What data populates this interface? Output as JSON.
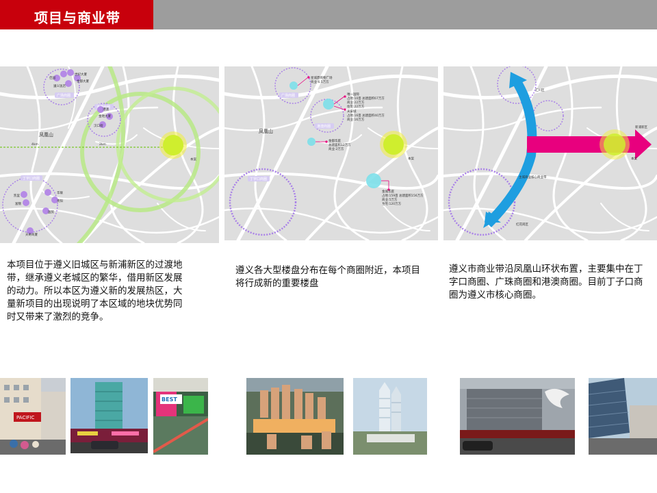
{
  "header": {
    "title": "项目与商业带",
    "accent_color": "#c8000c",
    "bar_color": "#9d9d9d"
  },
  "maps": [
    {
      "labels": {
        "fenghuangshan": "凤凰山",
        "project": "本案",
        "km4": "4km",
        "km2": "2km",
        "ring_a": "广场商圈",
        "ring_b": "港澳商圈",
        "ring_c": "丁字口商圈",
        "p1": "世纪大厦",
        "p2": "金都大厦",
        "p3": "佳园",
        "p4": "遵义饭店",
        "p5": "金地大厦",
        "p6": "汉口街",
        "p7": "港澳",
        "p8": "凯里",
        "p9": "富锦",
        "p10": "华联",
        "p11": "贵阳",
        "p12": "国贸",
        "p13": "天奇商厦"
      }
    },
    {
      "labels": {
        "fenghuangshan": "凤凰山",
        "project": "本案",
        "ring_a": "广场商圈",
        "ring_b": "港澳商圈",
        "ring_c": "丁字口商圈",
        "c1": "星城鼎购物广场",
        "c1b": "商业:6.5万方",
        "c2": "唯一国际",
        "c2b": "占地:10亩 总建面积67万方",
        "c2c": "商业:22万方",
        "c2d": "住宅:22万方",
        "c3": "天安城",
        "c3b": "占地:16亩 总建面积40万方",
        "c3c": "商业:16万方",
        "c4": "金都华庭",
        "c4b": "总建面积12万方",
        "c4c": "商业:2万方",
        "c5": "金城华庭",
        "c5b": "占地:159亩 总建面积156万方",
        "c5c": "商业:5万方",
        "c5d": "住宅:120万方"
      }
    },
    {
      "labels": {
        "huichuan": "汇川区",
        "xinpu": "新浦新区",
        "project": "本案",
        "honghuagang": "红花岗区",
        "core": "主城商业核心商业带"
      },
      "arrow_colors": {
        "blue": "#1e9ee0",
        "magenta": "#e8007e"
      }
    }
  ],
  "descriptions": [
    "本项目位于遵义旧城区与新浦新区的过渡地带，继承遵义老城区的繁华，借用新区发展的动力。所以本区为遵义新的发展热区，大量新项目的出现说明了本区域的地块优势同时又带来了激烈的竞争。",
    "遵义各大型楼盘分布在每个商圈附近，本项目将行成新的重要楼盘",
    "遵义市商业带沿凤凰山环状布置，主要集中在丁字口商圈、广珠商圈和港澳商圈。目前丁子口商圈为遵义市核心商圈。"
  ],
  "photos": {
    "p1_sign": "PACIFIC",
    "p3_sign": "BEST"
  }
}
